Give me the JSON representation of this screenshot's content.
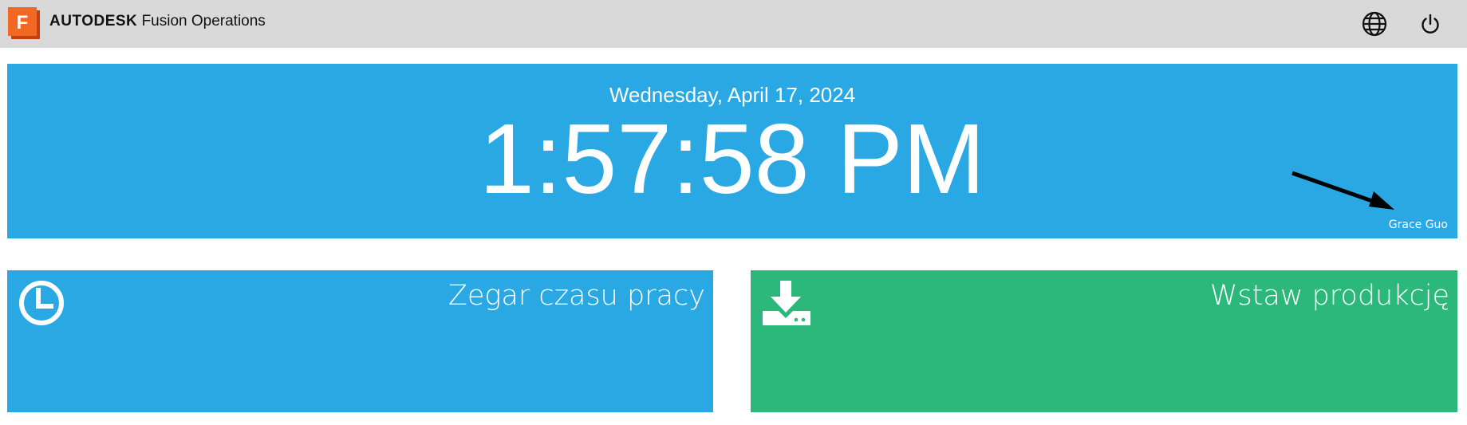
{
  "header": {
    "logo_letter": "F",
    "brand_bold": "AUTODESK",
    "brand_product": "Fusion Operations",
    "icons": [
      "globe-icon",
      "power-icon"
    ]
  },
  "clock": {
    "date": "Wednesday, April 17, 2024",
    "time": "1:57:58 PM",
    "user": "Grace Guo"
  },
  "tiles": [
    {
      "label": "Zegar czasu pracy",
      "icon": "clock-icon",
      "color": "#29a8e3"
    },
    {
      "label": "Wstaw produkcję",
      "icon": "download-icon",
      "color": "#2bb87a"
    }
  ],
  "colors": {
    "topbar": "#d9d9d9",
    "banner": "#29a8e3",
    "logo_orange": "#f26722"
  }
}
